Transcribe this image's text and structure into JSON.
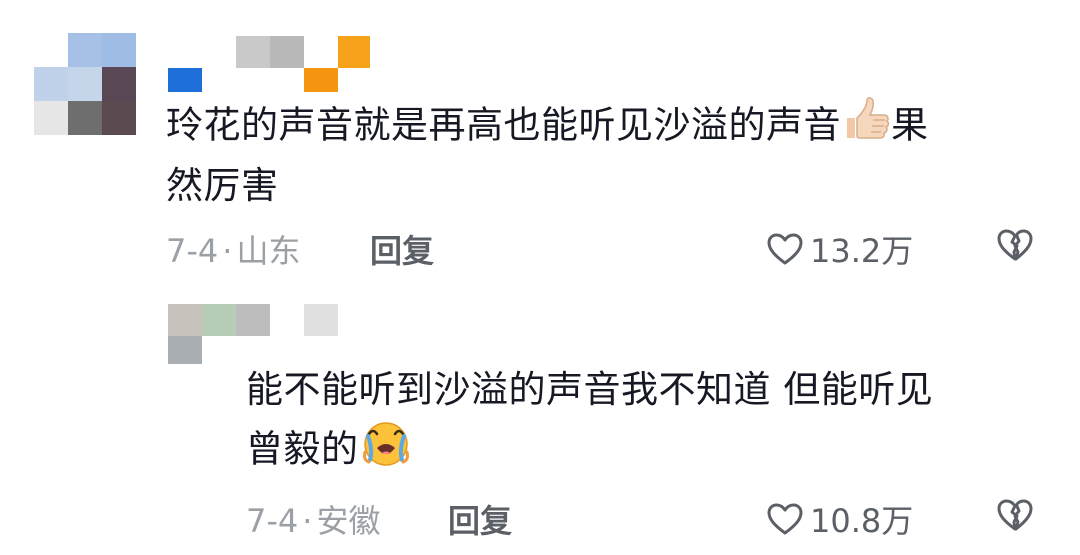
{
  "comments": [
    {
      "text_line1": "玲花的声音就是再高也能听见沙溢的声音",
      "emoji": "thumbs-up",
      "text_line1_tail": "果",
      "text_line2": "然厉害",
      "date": "7-4",
      "separator": "·",
      "location": "山东",
      "reply_label": "回复",
      "like_count": "13.2万"
    },
    {
      "text_line1": "能不能听到沙溢的声音我不知道 但能听见",
      "text_line2": "曾毅的",
      "emoji": "crying-face",
      "date": "7-4",
      "separator": "·",
      "location": "安徽",
      "reply_label": "回复",
      "like_count": "10.8万"
    }
  ],
  "colors": {
    "text": "#161823",
    "meta": "#9aa0a6",
    "action": "#5b5f66",
    "username_blue": "#1e6fd9",
    "username_orange": "#f7a21b"
  }
}
